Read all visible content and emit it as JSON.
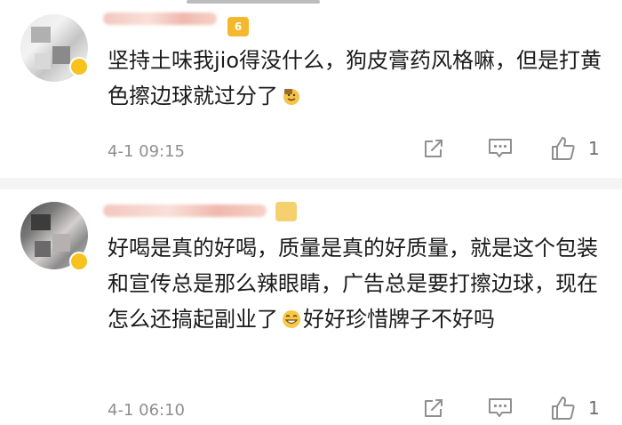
{
  "comments": [
    {
      "text": "坚持土味我jio得没什么，狗皮膏药风格嘛，但是打黄色擦边球就过分了",
      "emoji": "sweat-emoji",
      "time": "4-1 09:15",
      "likes": "1",
      "level_icon": "crown-vip-icon",
      "level_text": "6"
    },
    {
      "text": "好喝是真的好喝，质量是真的好质量，就是这个包装和宣传总是那么辣眼睛，广告总是要打擦边球，现在怎么还搞起副业了",
      "text_tail": "好好珍惜牌子不好吗",
      "emoji": "grin-emoji",
      "time": "4-1 06:10",
      "likes": "1"
    }
  ],
  "colors": {
    "text": "#1b1b1b",
    "meta": "#8f8f8f",
    "separator": "#f4f4f4",
    "badge": "#f7c21c"
  },
  "icons": {
    "share": "share-icon",
    "comment": "comment-icon",
    "like": "thumbs-up-icon"
  }
}
